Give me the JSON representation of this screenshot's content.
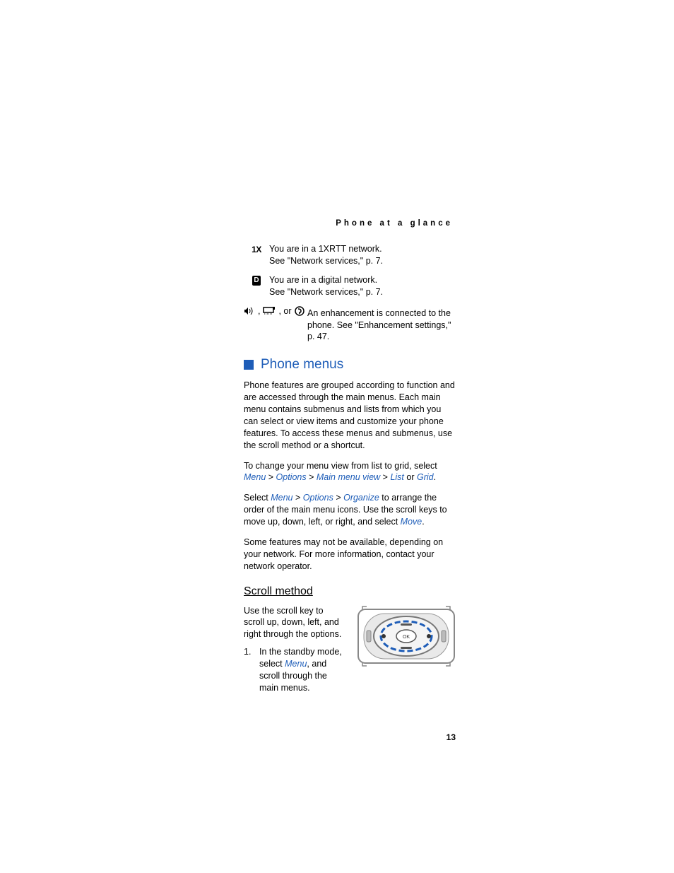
{
  "running_header": "Phone at a glance",
  "icons": {
    "row1": {
      "glyph": "1X",
      "line1": "You are in a 1XRTT network.",
      "line2": "See \"Network services,\" p. 7."
    },
    "row2": {
      "glyph": "D",
      "line1": "You are in a digital network.",
      "line2": "See \"Network services,\" p. 7."
    },
    "enh": {
      "sep1": ",",
      "sep2": ", or",
      "line1": "An enhancement is connected to the",
      "line2": "phone. See \"Enhancement settings,\" p. 47."
    }
  },
  "section": {
    "heading": "Phone menus",
    "p1": "Phone features are grouped according to function and are accessed through the main menus. Each main menu contains submenus and lists from which you can select or view items and customize your phone features. To access these menus and submenus, use the scroll method or a shortcut.",
    "p2_pre": "To change your menu view from list to grid, select ",
    "p2_menu": "Menu",
    "p2_gt1": " > ",
    "p2_options": "Options",
    "p2_gt2": " > ",
    "p2_mmv": "Main menu view",
    "p2_gt3": " > ",
    "p2_list": "List",
    "p2_or": " or ",
    "p2_grid": "Grid",
    "p2_end": ".",
    "p3_pre": "Select ",
    "p3_menu": "Menu",
    "p3_gt1": " > ",
    "p3_options": "Options",
    "p3_gt2": " > ",
    "p3_organize": "Organize",
    "p3_post": " to arrange the order of the main menu icons. Use the scroll keys to move up, down, left, or right, and select ",
    "p3_move": "Move",
    "p3_end": ".",
    "p4": "Some features may not be available, depending on your network. For more information, contact your network operator."
  },
  "scroll": {
    "heading": "Scroll method",
    "p1": "Use the scroll key to scroll up, down, left, and right through the options.",
    "ol1_num": "1.",
    "ol1_pre": "In the standby mode, select ",
    "ol1_menu": "Menu",
    "ol1_post": ", and scroll through the main menus.",
    "ok_label": "OK"
  },
  "page_number": "13"
}
